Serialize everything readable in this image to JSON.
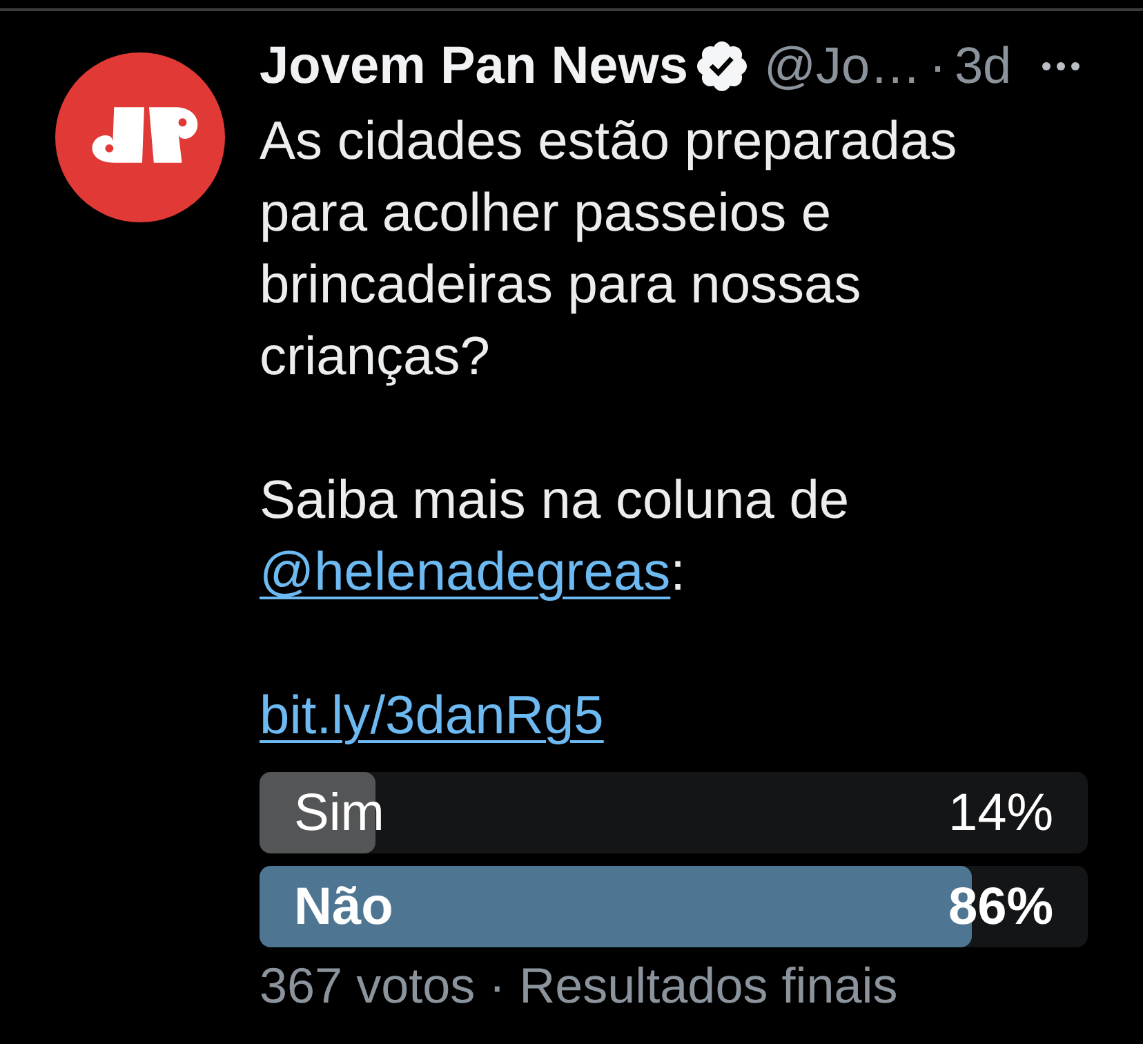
{
  "author": {
    "name": "Jovem Pan News",
    "verified": true,
    "handle": "@Jo…",
    "separator": "·",
    "time": "3d"
  },
  "body": [
    {
      "segments": [
        {
          "kind": "text",
          "text": "As cidades estão preparadas para acolher passeios e brincadeiras para nossas crianças?"
        }
      ]
    },
    {
      "segments": [
        {
          "kind": "text",
          "text": "Saiba mais na coluna de "
        },
        {
          "kind": "mention",
          "text": "@helenadegreas"
        },
        {
          "kind": "text",
          "text": ":"
        }
      ]
    },
    {
      "segments": [
        {
          "kind": "link",
          "text": "bit.ly/3danRg5"
        }
      ]
    }
  ],
  "poll": {
    "options": [
      {
        "label": "Sim",
        "percent": "14%",
        "level": 0.14,
        "winner": false
      },
      {
        "label": "Não",
        "percent": "86%",
        "level": 0.86,
        "winner": true
      }
    ],
    "footer": "367 votos · Resultados finais"
  }
}
